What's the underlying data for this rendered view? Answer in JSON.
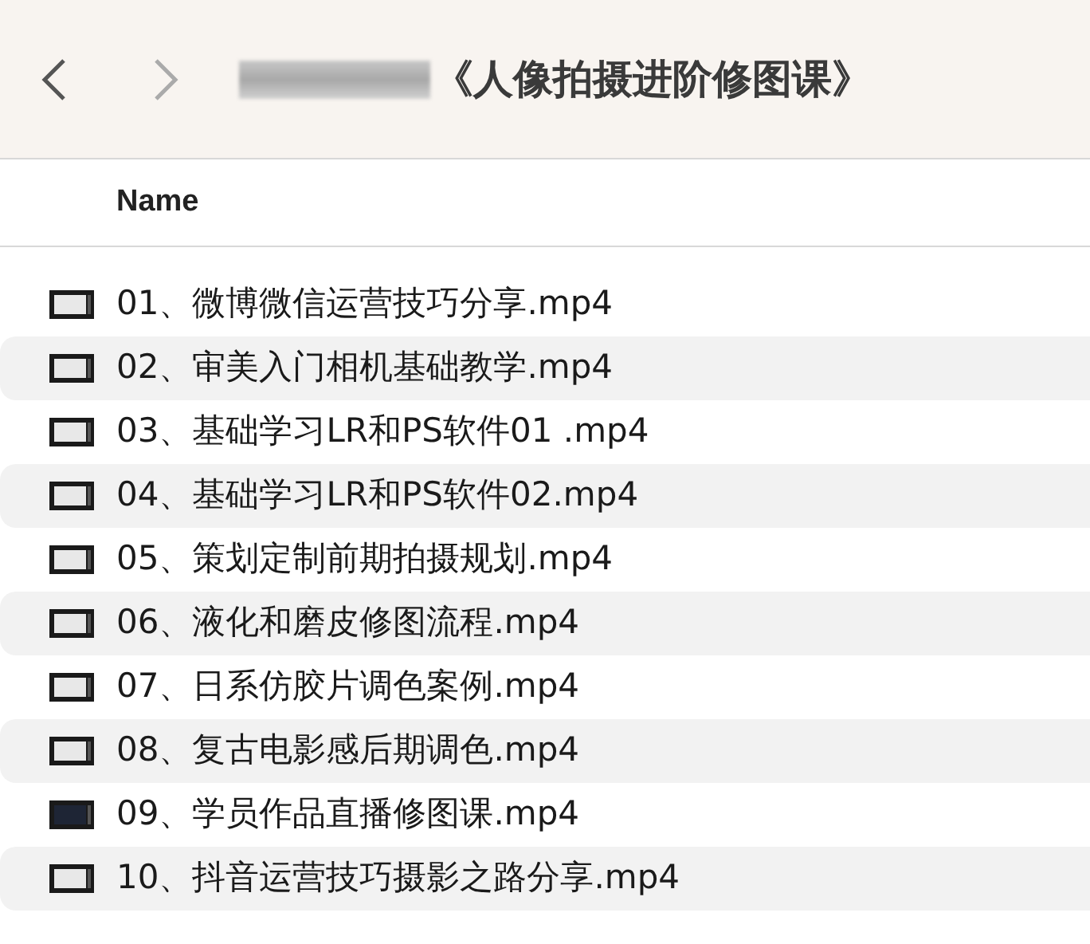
{
  "window": {
    "title": "《人像拍摄进阶修图课》"
  },
  "table": {
    "columns": [
      "Name"
    ],
    "rows": [
      {
        "name": "01、微博微信运营技巧分享.mp4",
        "kind": "light"
      },
      {
        "name": "02、审美入门相机基础教学.mp4",
        "kind": "light"
      },
      {
        "name": "03、基础学习LR和PS软件01 .mp4",
        "kind": "light"
      },
      {
        "name": "04、基础学习LR和PS软件02.mp4",
        "kind": "light"
      },
      {
        "name": "05、策划定制前期拍摄规划.mp4",
        "kind": "light"
      },
      {
        "name": "06、液化和磨皮修图流程.mp4",
        "kind": "light"
      },
      {
        "name": "07、日系仿胶片调色案例.mp4",
        "kind": "light"
      },
      {
        "name": "08、复古电影感后期调色.mp4",
        "kind": "light"
      },
      {
        "name": "09、学员作品直播修图课.mp4",
        "kind": "dark"
      },
      {
        "name": "10、抖音运营技巧摄影之路分享.mp4",
        "kind": "light"
      }
    ]
  }
}
